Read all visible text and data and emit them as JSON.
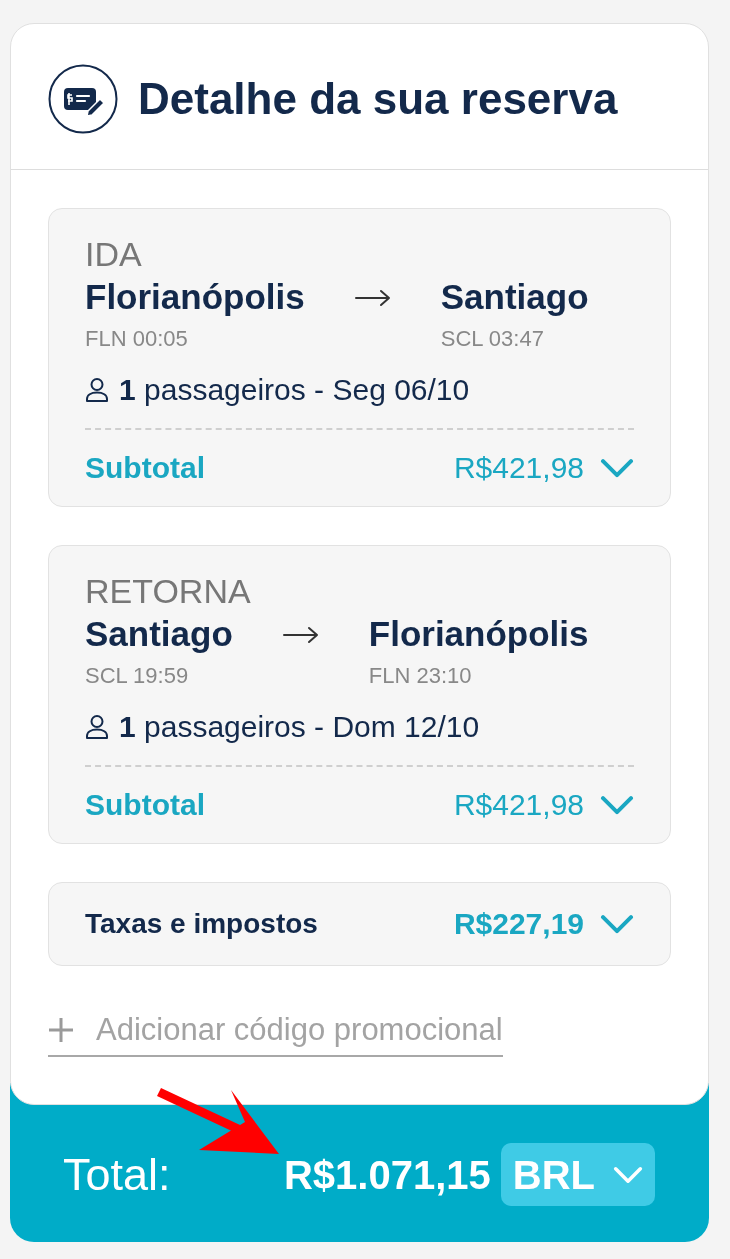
{
  "header": {
    "title": "Detalhe da sua reserva"
  },
  "segments": [
    {
      "direction": "IDA",
      "origin": {
        "city": "Florianópolis",
        "code_time": "FLN 00:05"
      },
      "destination": {
        "city": "Santiago",
        "code_time": "SCL 03:47"
      },
      "passengers": "**1** passageiros - Seg 06/10",
      "subtotal_label": "Subtotal",
      "subtotal": "R$421,98",
      "expanded": false
    },
    {
      "direction": "RETORNA",
      "origin": {
        "city": "Santiago",
        "code_time": "SCL 19:59"
      },
      "destination": {
        "city": "Florianópolis",
        "code_time": "FLN 23:10"
      },
      "passengers": "**1** passageiros - Dom 12/10",
      "subtotal_label": "Subtotal",
      "subtotal": "R$421,98",
      "expanded": false
    }
  ],
  "taxes": {
    "label": "Taxas e impostos",
    "amount": "R$227,19",
    "expanded": false
  },
  "promo": {
    "label": "Adicionar código promocional"
  },
  "total": {
    "label": "Total:",
    "amount": "R$1.071,15",
    "currency": "BRL"
  }
}
